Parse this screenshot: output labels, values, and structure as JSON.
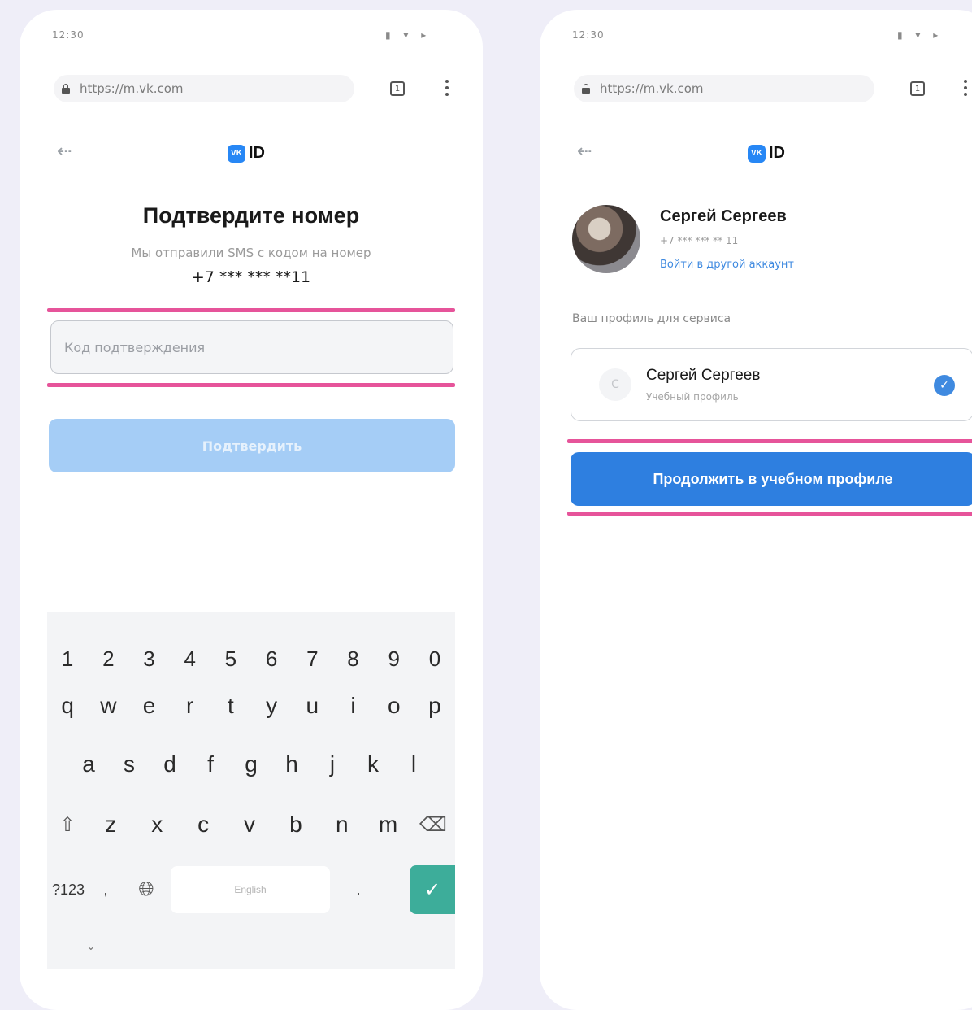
{
  "left": {
    "status": {
      "time": "12:30",
      "icons": "▮ ▾ ▸"
    },
    "browser": {
      "url": "https://m.vk.com",
      "tabs_count": "1"
    },
    "header": {
      "logo_text": "VK",
      "id_text": "ID"
    },
    "title": "Подтвердите номер",
    "subtitle": "Мы отправили SMS с кодом на номер",
    "phone": "+7 *** *** **11",
    "code_input": {
      "placeholder": "Код подтверждения",
      "value": ""
    },
    "submit_label": "Подтвердить",
    "keyboard": {
      "numbers": [
        "1",
        "2",
        "3",
        "4",
        "5",
        "6",
        "7",
        "8",
        "9",
        "0"
      ],
      "row1": [
        "q",
        "w",
        "e",
        "r",
        "t",
        "y",
        "u",
        "i",
        "o",
        "p"
      ],
      "row2": [
        "a",
        "s",
        "d",
        "f",
        "g",
        "h",
        "j",
        "k",
        "l"
      ],
      "row3": [
        "z",
        "x",
        "c",
        "v",
        "b",
        "n",
        "m"
      ],
      "symbols_label": "?123",
      "comma": ",",
      "space_label": "English",
      "period": "."
    }
  },
  "right": {
    "status": {
      "time": "12:30",
      "icons": "▮ ▾ ▸"
    },
    "browser": {
      "url": "https://m.vk.com",
      "tabs_count": "1"
    },
    "header": {
      "logo_text": "VK",
      "id_text": "ID"
    },
    "user": {
      "name": "Сергей Сергеев",
      "phone": "+7 *** *** ** 11",
      "switch_account": "Войти в другой аккаунт"
    },
    "profile_section_label": "Ваш профиль для сервиса",
    "profile_card": {
      "name": "Сергей Сергеев",
      "type": "Учебный профиль",
      "initials": "С"
    },
    "continue_label": "Продолжить в учебном профиле"
  },
  "colors": {
    "highlight": "#e6549a",
    "primary_button": "#2e7fe0",
    "disabled_button": "#a5cdf6",
    "vk_blue": "#2787f5",
    "enter_key": "#3dad9a",
    "page_bg": "#efeef8"
  }
}
